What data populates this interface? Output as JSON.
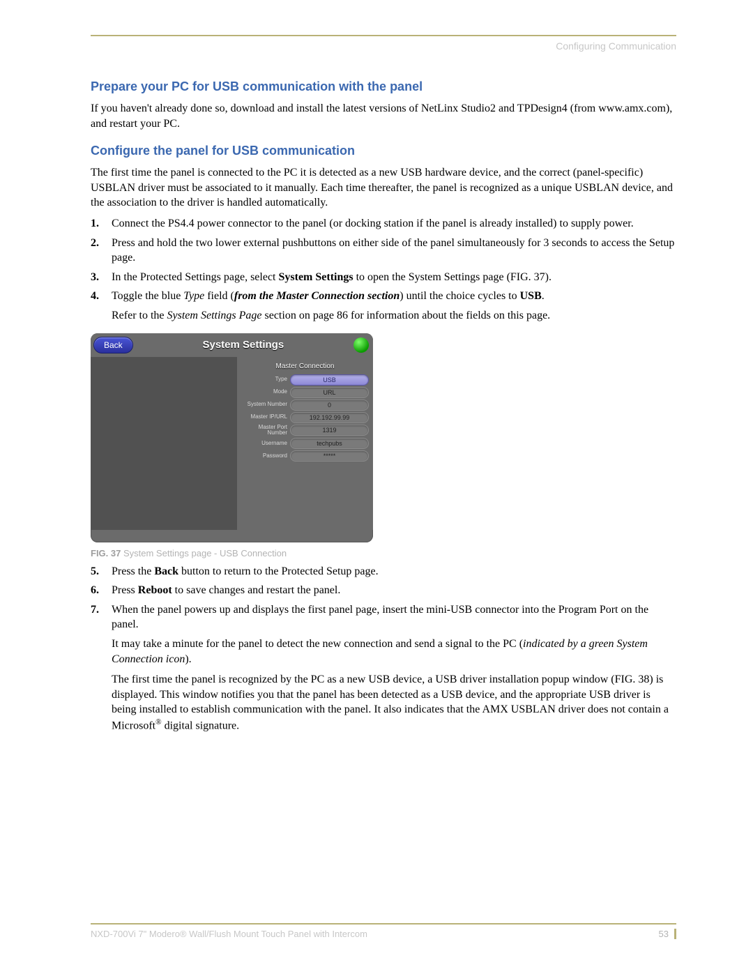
{
  "header": {
    "section": "Configuring Communication"
  },
  "h1": "Prepare your PC for USB communication with the panel",
  "p1": "If you haven't already done so, download and install the latest versions of NetLinx Studio2 and TPDesign4 (from www.amx.com), and restart your PC.",
  "h2": "Configure the panel for USB communication",
  "p2": "The first time the panel is connected to the PC it is detected as a new USB hardware device, and the correct (panel-specific) USBLAN driver must be associated to it manually. Each time thereafter, the panel is recognized as a unique USBLAN device, and the association to the driver is handled automatically.",
  "steps_a": {
    "s1": "Connect the PS4.4 power connector to the panel (or docking station if the panel is already installed) to supply power.",
    "s2": "Press and hold the two lower external pushbuttons on either side of the panel simultaneously for 3 seconds to access the Setup page.",
    "s3_a": "In the Protected Settings page, select ",
    "s3_b": "System Settings",
    "s3_c": " to open the System Settings page (FIG. 37).",
    "s4_a": "Toggle the blue ",
    "s4_b": "Type",
    "s4_c": " field (",
    "s4_d": "from the Master Connection section",
    "s4_e": ") until the choice cycles to ",
    "s4_f": "USB",
    "s4_g": ".",
    "s4_p2a": "Refer to the ",
    "s4_p2b": "System Settings Page",
    "s4_p2c": " section on page 86 for information about the fields on this page."
  },
  "fig": {
    "back": "Back",
    "title": "System Settings",
    "sub": "Master Connection",
    "rows": {
      "type_l": "Type",
      "type_v": "USB",
      "mode_l": "Mode",
      "mode_v": "URL",
      "sysnum_l": "System Number",
      "sysnum_v": "0",
      "ip_l": "Master IP/URL",
      "ip_v": "192.192.99.99",
      "port_l": "Master Port Number",
      "port_v": "1319",
      "user_l": "Username",
      "user_v": "techpubs",
      "pass_l": "Password",
      "pass_v": "*****"
    },
    "cap_no": "FIG. 37",
    "cap_txt": "  System Settings page - USB Connection"
  },
  "steps_b": {
    "s5_a": "Press the ",
    "s5_b": "Back",
    "s5_c": " button to return to the Protected Setup page.",
    "s6_a": "Press ",
    "s6_b": "Reboot",
    "s6_c": " to save changes and restart the panel.",
    "s7_p1": "When the panel powers up and displays the first panel page, insert the mini-USB connector into the Program Port on the panel.",
    "s7_p2a": "It may take a minute for the panel to detect the new connection and send a signal to the PC (",
    "s7_p2b": "indicated by a green System Connection icon",
    "s7_p2c": ").",
    "s7_p3a": "The first time the panel is recognized by the PC as a new USB device, a USB driver installation popup window (FIG. 38) is displayed. This window notifies you that the panel has been detected as a USB device, and the appropriate USB driver is being installed to establish communication with the panel. It also indicates that the AMX USBLAN driver does not contain a Microsoft",
    "s7_p3b": " digital signature."
  },
  "footer": {
    "doc": "NXD-700Vi 7\" Modero® Wall/Flush Mount Touch Panel with Intercom",
    "page": "53"
  }
}
